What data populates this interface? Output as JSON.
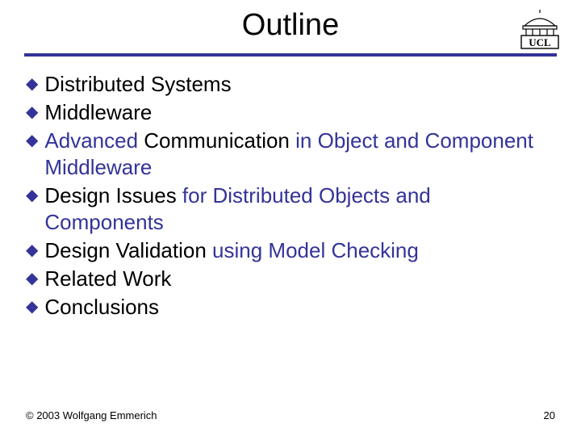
{
  "title": "Outline",
  "logo_text": "UCL",
  "bullets": [
    {
      "pre": "",
      "emph": "Distributed Systems",
      "post": ""
    },
    {
      "pre": "",
      "emph": "Middleware",
      "post": ""
    },
    {
      "pre": "Advanced ",
      "emph": "Communication",
      "post": " in Object and Component Middleware"
    },
    {
      "pre": "",
      "emph": "Design Issues",
      "post": " for Distributed Objects and Components"
    },
    {
      "pre": "",
      "emph": "Design Validation",
      "post": " using Model Checking"
    },
    {
      "pre": "",
      "emph": "Related Work",
      "post": ""
    },
    {
      "pre": "",
      "emph": "Conclusions",
      "post": ""
    }
  ],
  "footer_left": "© 2003 Wolfgang Emmerich",
  "footer_right": "20"
}
